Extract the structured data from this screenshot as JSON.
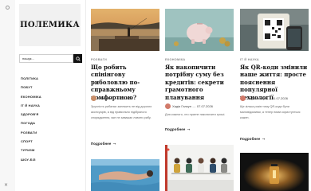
{
  "site": {
    "logo": "ПОЛЕМИКА"
  },
  "search": {
    "placeholder": "пошук..."
  },
  "nav": {
    "items": [
      "Політика",
      "Побут",
      "Економіка",
      "IT й Наука",
      "Здоров'я",
      "Погода",
      "Розваги",
      "Спорт",
      "Туризм",
      "Шоу-біз"
    ]
  },
  "sidebar": {
    "close_icon": "×"
  },
  "articles": [
    {
      "category": "Розваги",
      "title": "Що робить спінінгову риболовлю по-справжньому комфортною?",
      "author": "Polemika",
      "date": "05.07.2026",
      "excerpt": "Зручність рибалки залежить не від дорогих аксесуарів, а від правильно підібраного спорядження, яке не заважає ловити рибу.",
      "more": "Подробнее"
    },
    {
      "category": "Економіка",
      "title": "Як накопичити потрібну суму без кредитів: секрети грамотного планування",
      "author": "Хадія Галкун",
      "date": "07.07.2026",
      "excerpt": "Для кожного, хто прагне накопичити гроші.",
      "more": "Подробнее"
    },
    {
      "category": "IT й Наука",
      "title": "Як QR-коди змінили наше життя: просте пояснення популярної технології",
      "author": "Хадія Галкун",
      "date": "01.07.2026",
      "excerpt": "Ще кілька років тому QR-коди були маловідомими, а тепер ними користується кожен.",
      "more": "Подробнее"
    }
  ]
}
